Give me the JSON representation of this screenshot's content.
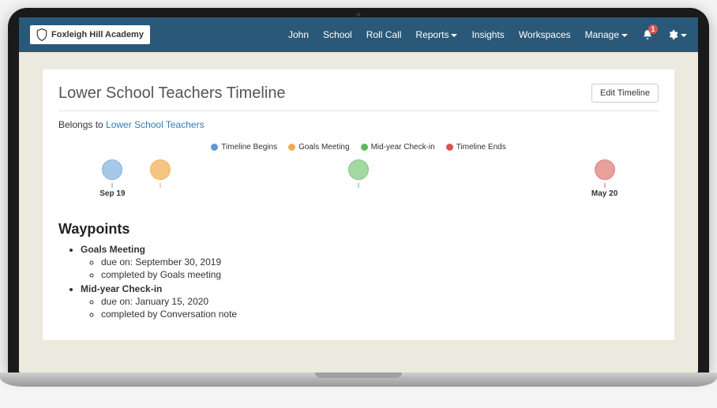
{
  "brand": "Foxleigh Hill Academy",
  "nav": {
    "user": "John",
    "school": "School",
    "roll_call": "Roll Call",
    "reports": "Reports",
    "insights": "Insights",
    "workspaces": "Workspaces",
    "manage": "Manage",
    "notifications_count": "1"
  },
  "header": {
    "title": "Lower School Teachers Timeline",
    "edit_label": "Edit Timeline"
  },
  "belongs": {
    "prefix": "Belongs to ",
    "link": "Lower School Teachers"
  },
  "legend": {
    "begins": "Timeline Begins",
    "goals": "Goals Meeting",
    "midyear": "Mid-year Check-in",
    "ends": "Timeline Ends"
  },
  "timeline": {
    "start_label": "Sep 19",
    "end_label": "May 20",
    "nodes": {
      "begins": {
        "left_pct": 9
      },
      "goals": {
        "left_pct": 17
      },
      "midyear": {
        "left_pct": 50
      },
      "ends": {
        "left_pct": 91
      }
    }
  },
  "waypoints": {
    "heading": "Waypoints",
    "items": [
      {
        "title": "Goals Meeting",
        "due_label": "due on: September 30, 2019",
        "completed_label": "completed by Goals meeting"
      },
      {
        "title": "Mid-year Check-in",
        "due_label": "due on: January 15, 2020",
        "completed_label": "completed by Conversation note"
      }
    ]
  }
}
